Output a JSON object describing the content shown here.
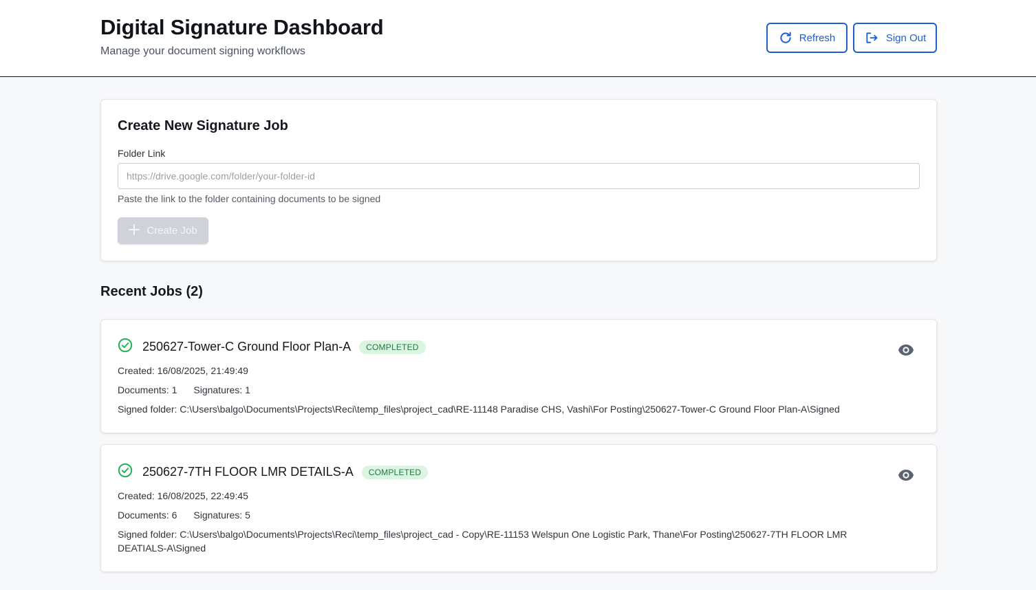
{
  "header": {
    "title": "Digital Signature Dashboard",
    "subtitle": "Manage your document signing workflows",
    "refresh_label": "Refresh",
    "signout_label": "Sign Out"
  },
  "create_job": {
    "title": "Create New Signature Job",
    "folder_label": "Folder Link",
    "folder_placeholder": "https://drive.google.com/folder/your-folder-id",
    "folder_value": "",
    "help_text": "Paste the link to the folder containing documents to be signed",
    "button_label": "Create Job"
  },
  "recent": {
    "title": "Recent Jobs (2)",
    "jobs": [
      {
        "name": "250627-Tower-C Ground Floor Plan-A",
        "status": "COMPLETED",
        "created": "Created: 16/08/2025, 21:49:49",
        "documents": "Documents: 1",
        "signatures": "Signatures: 1",
        "signed_folder": "Signed folder: C:\\Users\\balgo\\Documents\\Projects\\Reci\\temp_files\\project_cad\\RE-11148 Paradise CHS, Vashi\\For Posting\\250627-Tower-C Ground Floor Plan-A\\Signed"
      },
      {
        "name": "250627-7TH FLOOR LMR DETAILS-A",
        "status": "COMPLETED",
        "created": "Created: 16/08/2025, 22:49:45",
        "documents": "Documents: 6",
        "signatures": "Signatures: 5",
        "signed_folder": "Signed folder: C:\\Users\\balgo\\Documents\\Projects\\Reci\\temp_files\\project_cad - Copy\\RE-11153 Welspun One Logistic Park, Thane\\For Posting\\250627-7TH FLOOR LMR DEATIALS-A\\Signed"
      }
    ]
  },
  "icons": {
    "refresh": "refresh-icon",
    "signout": "sign-out-icon",
    "plus": "plus-icon",
    "status": "check-circle-icon",
    "view": "eye-icon"
  },
  "colors": {
    "accent": "#1d5fd0",
    "success": "#22b357",
    "badge_bg": "#dcf5e3",
    "badge_text": "#1f7a3d",
    "disabled": "#cfd2d8"
  }
}
